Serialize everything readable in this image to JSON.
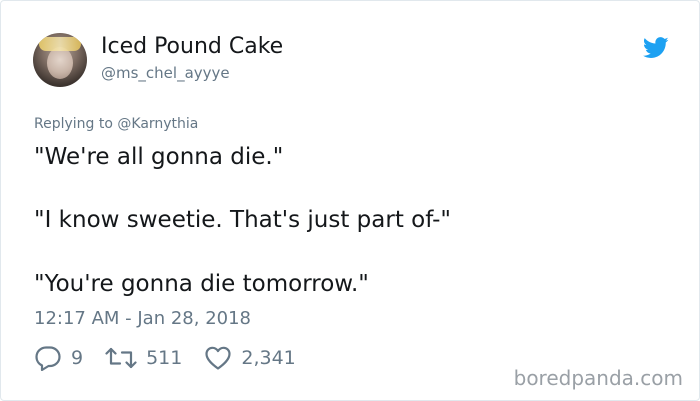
{
  "tweet": {
    "author_name": "Iced Pound Cake",
    "author_handle": "@ms_chel_ayyye",
    "replying_to": "Replying to @Karnythia",
    "lines": [
      "\"We're all gonna die.\"",
      "\"I know sweetie. That's just part of-\"",
      "\"You're gonna die tomorrow.\""
    ],
    "timestamp": "12:17 AM - Jan 28, 2018",
    "stats": {
      "replies": "9",
      "retweets": "511",
      "likes": "2,341"
    }
  },
  "watermark": "boredpanda.com",
  "colors": {
    "twitter_blue": "#1da1f2",
    "text_primary": "#14171a",
    "text_secondary": "#657786"
  },
  "icons": {
    "logo": "twitter-bird-icon",
    "reply": "reply-icon",
    "retweet": "retweet-icon",
    "like": "heart-icon"
  }
}
